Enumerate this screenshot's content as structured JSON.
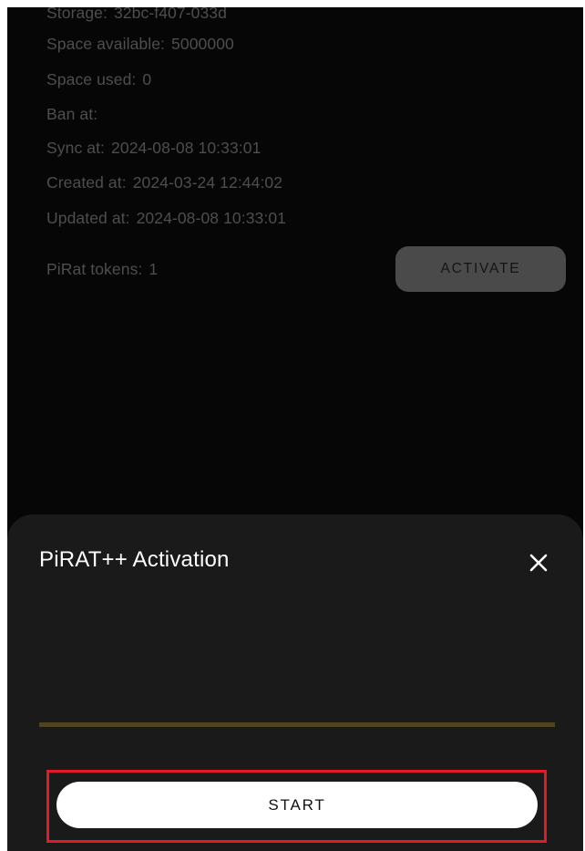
{
  "details": {
    "storage": {
      "label": "Storage:",
      "value": "32bc-f407-033d"
    },
    "space_available": {
      "label": "Space available:",
      "value": "5000000"
    },
    "space_used": {
      "label": "Space used:",
      "value": "0"
    },
    "ban_at": {
      "label": "Ban at:",
      "value": ""
    },
    "sync_at": {
      "label": "Sync at:",
      "value": "2024-08-08 10:33:01"
    },
    "created_at": {
      "label": "Created at:",
      "value": "2024-03-24 12:44:02"
    },
    "updated_at": {
      "label": "Updated at:",
      "value": "2024-08-08 10:33:01"
    }
  },
  "tokens": {
    "label": "PiRat tokens:",
    "value": "1",
    "activate_label": "ACTIVATE"
  },
  "sheet": {
    "title": "PiRAT++ Activation",
    "close_icon": "close-icon",
    "start_label": "START"
  },
  "colors": {
    "background": "#060606",
    "sheet": "#1a1a1a",
    "progress_track": "#4d4420",
    "highlight": "#e01b24"
  }
}
